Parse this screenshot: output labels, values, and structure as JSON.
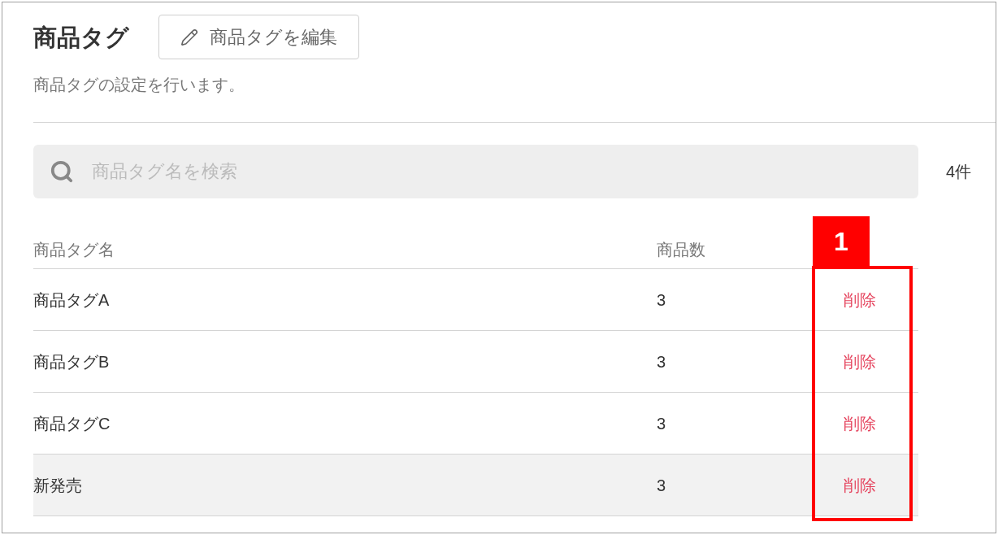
{
  "header": {
    "title": "商品タグ",
    "edit_button": "商品タグを編集",
    "description": "商品タグの設定を行います。"
  },
  "search": {
    "placeholder": "商品タグ名を検索"
  },
  "result_count": "4件",
  "table": {
    "columns": [
      "商品タグ名",
      "商品数"
    ],
    "rows": [
      {
        "name": "商品タグA",
        "count": "3",
        "action": "削除",
        "highlighted": false
      },
      {
        "name": "商品タグB",
        "count": "3",
        "action": "削除",
        "highlighted": false
      },
      {
        "name": "商品タグC",
        "count": "3",
        "action": "削除",
        "highlighted": false
      },
      {
        "name": "新発売",
        "count": "3",
        "action": "削除",
        "highlighted": true
      }
    ]
  },
  "annotation": {
    "label": "1"
  }
}
